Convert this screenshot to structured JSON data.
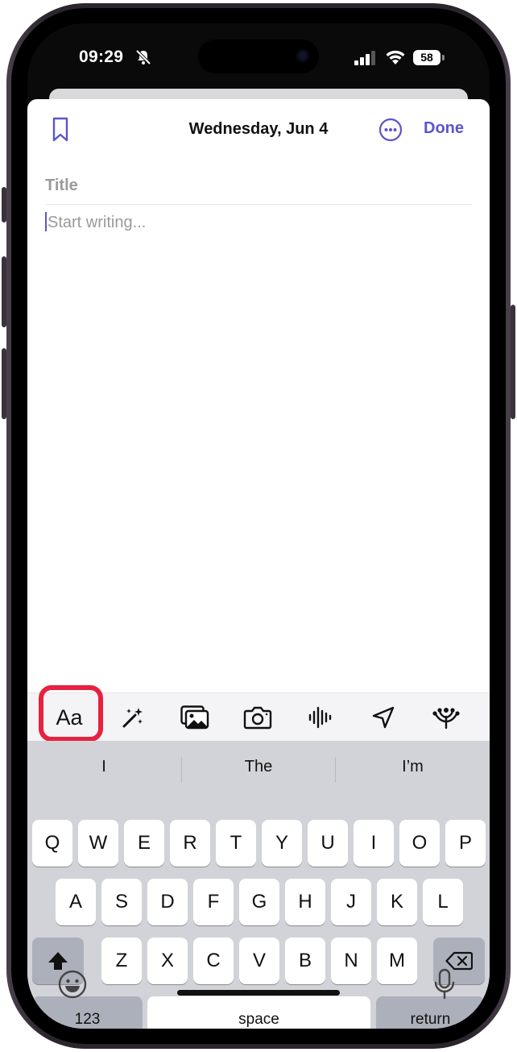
{
  "status_bar": {
    "time": "09:29",
    "battery": "58",
    "icons": [
      "bell-slash-icon",
      "cellular-signal-icon",
      "wifi-icon",
      "battery-icon"
    ]
  },
  "header": {
    "date": "Wednesday, Jun 4",
    "done_label": "Done",
    "icons": [
      "bookmark-icon",
      "more-icon"
    ]
  },
  "editor": {
    "title_placeholder": "Title",
    "body_placeholder": "Start writing..."
  },
  "toolbar": {
    "format_label": "Aa",
    "icons": [
      "magic-wand-icon",
      "photo-library-icon",
      "camera-icon",
      "audio-waveform-icon",
      "location-arrow-icon",
      "reflection-icon"
    ]
  },
  "keyboard": {
    "suggestions": [
      "I",
      "The",
      "I’m"
    ],
    "row1": [
      "Q",
      "W",
      "E",
      "R",
      "T",
      "Y",
      "U",
      "I",
      "O",
      "P"
    ],
    "row2": [
      "A",
      "S",
      "D",
      "F",
      "G",
      "H",
      "J",
      "K",
      "L"
    ],
    "row3": [
      "Z",
      "X",
      "C",
      "V",
      "B",
      "N",
      "M"
    ],
    "numbers_label": "123",
    "space_label": "space",
    "return_label": "return",
    "icons": [
      "shift-icon",
      "delete-icon",
      "emoji-icon",
      "microphone-icon"
    ]
  },
  "colors": {
    "accent": "#5b56c7",
    "highlight": "#e8213f",
    "keyboard_bg": "#d1d3d9"
  }
}
